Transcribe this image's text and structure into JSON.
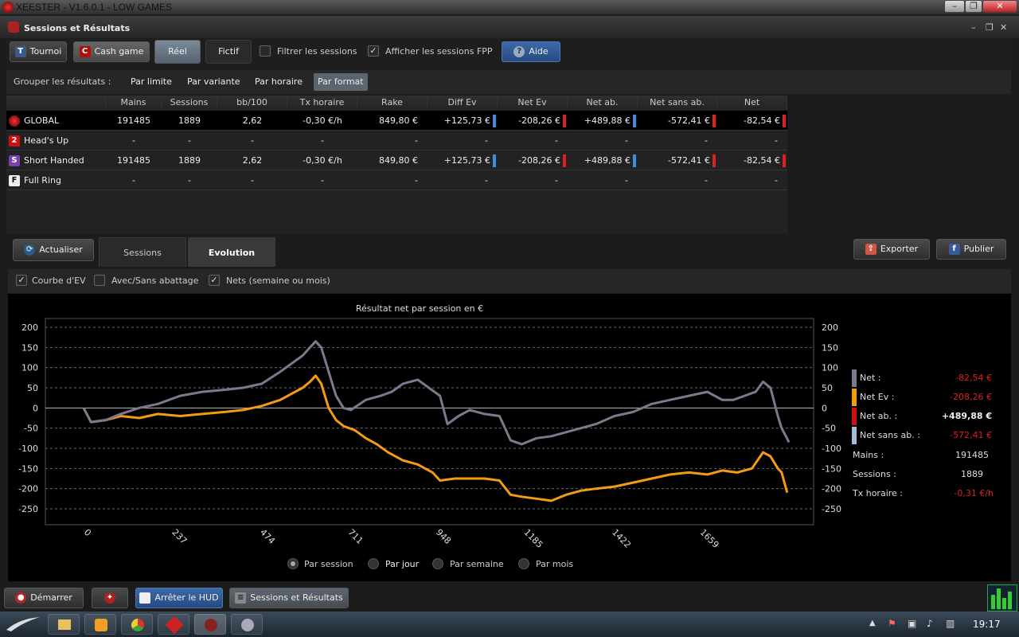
{
  "window": {
    "title": "XEESTER - V1.6.0.1 - LOW GAMES"
  },
  "subwindow": {
    "title": "Sessions et Résultats"
  },
  "toolbar": {
    "tournoi": "Tournoi",
    "tournoi_badge": "T",
    "cash": "Cash game",
    "cash_badge": "C",
    "reel": "Réel",
    "fictif": "Fictif",
    "filtrer": "Filtrer les sessions",
    "filtrer_checked": false,
    "afficher_fpp": "Afficher les sessions FPP",
    "afficher_fpp_checked": true,
    "aide": "Aide"
  },
  "group": {
    "label": "Grouper les résultats :",
    "options": [
      "Par limite",
      "Par variante",
      "Par horaire",
      "Par format"
    ],
    "active": "Par format"
  },
  "table": {
    "headers": [
      "Mains",
      "Sessions",
      "bb/100",
      "Tx horaire",
      "Rake",
      "Diff Ev",
      "Net Ev",
      "Net ab.",
      "Net sans ab.",
      "Net"
    ],
    "rows": [
      {
        "badge": "",
        "name": "GLOBAL",
        "cells": [
          "191485",
          "1889",
          "2,62",
          "-0,30 €/h",
          "849,80 €",
          "+125,73 €",
          "-208,26 €",
          "+489,88 €",
          "-572,41 €",
          "-82,54 €"
        ]
      },
      {
        "badge": "2",
        "name": "Head's Up",
        "cells": [
          "-",
          "-",
          "-",
          "-",
          "-",
          "-",
          "-",
          "-",
          "-",
          "-"
        ]
      },
      {
        "badge": "S",
        "name": "Short Handed",
        "cells": [
          "191485",
          "1889",
          "2,62",
          "-0,30 €/h",
          "849,80 €",
          "+125,73 €",
          "-208,26 €",
          "+489,88 €",
          "-572,41 €",
          "-82,54 €"
        ]
      },
      {
        "badge": "F",
        "name": "Full Ring",
        "cells": [
          "-",
          "-",
          "-",
          "-",
          "-",
          "-",
          "-",
          "-",
          "-",
          "-"
        ]
      }
    ]
  },
  "tabs": {
    "actualiser": "Actualiser",
    "sessions": "Sessions",
    "evolution": "Evolution",
    "exporter": "Exporter",
    "publier": "Publier"
  },
  "options": {
    "courbe_ev": "Courbe d'EV",
    "courbe_ev_checked": true,
    "avec_sans": "Avec/Sans abattage",
    "avec_sans_checked": false,
    "nets": "Nets (semaine ou mois)",
    "nets_checked": true
  },
  "legend": {
    "net_label": "Net :",
    "net_value": "-82,54 €",
    "netev_label": "Net Ev :",
    "netev_value": "-208,26 €",
    "netab_label": "Net ab. :",
    "netab_value": "+489,88 €",
    "netsans_label": "Net sans ab. :",
    "netsans_value": "-572,41 €",
    "mains_label": "Mains :",
    "mains_value": "191485",
    "sessions_label": "Sessions :",
    "sessions_value": "1889",
    "tx_label": "Tx horaire :",
    "tx_value": "-0,31 €/h"
  },
  "radios": {
    "options": [
      "Par session",
      "Par jour",
      "Par semaine",
      "Par mois"
    ],
    "selected": "Par session"
  },
  "bottom": {
    "demarrer": "Démarrer",
    "arreter": "Arrêter le HUD",
    "sessions": "Sessions et Résultats"
  },
  "taskbar": {
    "time": "19:17"
  },
  "colors": {
    "net": "#7a7a8e",
    "netev": "#f39c12",
    "netab": "#cc1111",
    "netsans": "#a8bcd8",
    "red": "#e02020",
    "blue": "#3a8fe0"
  },
  "chart_data": {
    "type": "line",
    "title": "Résultat net par session en €",
    "xlabel": "",
    "ylabel": "",
    "xlim": [
      0,
      1889
    ],
    "ylim": [
      -250,
      200
    ],
    "x_ticks": [
      0,
      237,
      474,
      711,
      948,
      1185,
      1422,
      1659
    ],
    "y_ticks": [
      200,
      150,
      100,
      50,
      0,
      -50,
      -100,
      -150,
      -200,
      -250
    ],
    "grid": true,
    "series": [
      {
        "name": "Net",
        "color": "#7a7a8e",
        "points": [
          [
            0,
            0
          ],
          [
            20,
            -35
          ],
          [
            60,
            -30
          ],
          [
            100,
            -15
          ],
          [
            150,
            0
          ],
          [
            200,
            10
          ],
          [
            260,
            30
          ],
          [
            320,
            40
          ],
          [
            380,
            45
          ],
          [
            430,
            50
          ],
          [
            480,
            60
          ],
          [
            530,
            90
          ],
          [
            560,
            110
          ],
          [
            590,
            130
          ],
          [
            610,
            150
          ],
          [
            625,
            165
          ],
          [
            640,
            150
          ],
          [
            660,
            90
          ],
          [
            680,
            30
          ],
          [
            700,
            0
          ],
          [
            720,
            -5
          ],
          [
            760,
            20
          ],
          [
            800,
            30
          ],
          [
            830,
            40
          ],
          [
            860,
            60
          ],
          [
            900,
            70
          ],
          [
            930,
            50
          ],
          [
            960,
            30
          ],
          [
            980,
            -40
          ],
          [
            1010,
            -20
          ],
          [
            1040,
            -5
          ],
          [
            1080,
            -15
          ],
          [
            1120,
            -20
          ],
          [
            1150,
            -80
          ],
          [
            1180,
            -90
          ],
          [
            1220,
            -75
          ],
          [
            1260,
            -70
          ],
          [
            1320,
            -55
          ],
          [
            1380,
            -40
          ],
          [
            1430,
            -20
          ],
          [
            1480,
            -10
          ],
          [
            1530,
            10
          ],
          [
            1580,
            20
          ],
          [
            1630,
            30
          ],
          [
            1680,
            40
          ],
          [
            1720,
            20
          ],
          [
            1750,
            20
          ],
          [
            1780,
            30
          ],
          [
            1810,
            40
          ],
          [
            1830,
            65
          ],
          [
            1850,
            50
          ],
          [
            1870,
            -20
          ],
          [
            1880,
            -50
          ],
          [
            1900,
            -85
          ]
        ]
      },
      {
        "name": "Net Ev",
        "color": "#f39c12",
        "points": [
          [
            0,
            0
          ],
          [
            20,
            -35
          ],
          [
            60,
            -30
          ],
          [
            100,
            -20
          ],
          [
            150,
            -25
          ],
          [
            200,
            -15
          ],
          [
            260,
            -20
          ],
          [
            320,
            -15
          ],
          [
            380,
            -10
          ],
          [
            430,
            -5
          ],
          [
            480,
            5
          ],
          [
            530,
            20
          ],
          [
            560,
            35
          ],
          [
            590,
            50
          ],
          [
            610,
            65
          ],
          [
            625,
            80
          ],
          [
            640,
            60
          ],
          [
            660,
            0
          ],
          [
            680,
            -30
          ],
          [
            700,
            -45
          ],
          [
            730,
            -55
          ],
          [
            760,
            -75
          ],
          [
            790,
            -90
          ],
          [
            820,
            -110
          ],
          [
            860,
            -130
          ],
          [
            900,
            -140
          ],
          [
            940,
            -160
          ],
          [
            960,
            -180
          ],
          [
            1000,
            -175
          ],
          [
            1040,
            -175
          ],
          [
            1080,
            -175
          ],
          [
            1120,
            -180
          ],
          [
            1150,
            -215
          ],
          [
            1180,
            -220
          ],
          [
            1220,
            -225
          ],
          [
            1260,
            -230
          ],
          [
            1300,
            -215
          ],
          [
            1340,
            -205
          ],
          [
            1380,
            -200
          ],
          [
            1430,
            -195
          ],
          [
            1480,
            -185
          ],
          [
            1530,
            -175
          ],
          [
            1580,
            -165
          ],
          [
            1630,
            -160
          ],
          [
            1680,
            -165
          ],
          [
            1720,
            -155
          ],
          [
            1760,
            -160
          ],
          [
            1800,
            -150
          ],
          [
            1830,
            -110
          ],
          [
            1850,
            -120
          ],
          [
            1870,
            -150
          ],
          [
            1880,
            -160
          ],
          [
            1895,
            -210
          ]
        ]
      }
    ]
  }
}
